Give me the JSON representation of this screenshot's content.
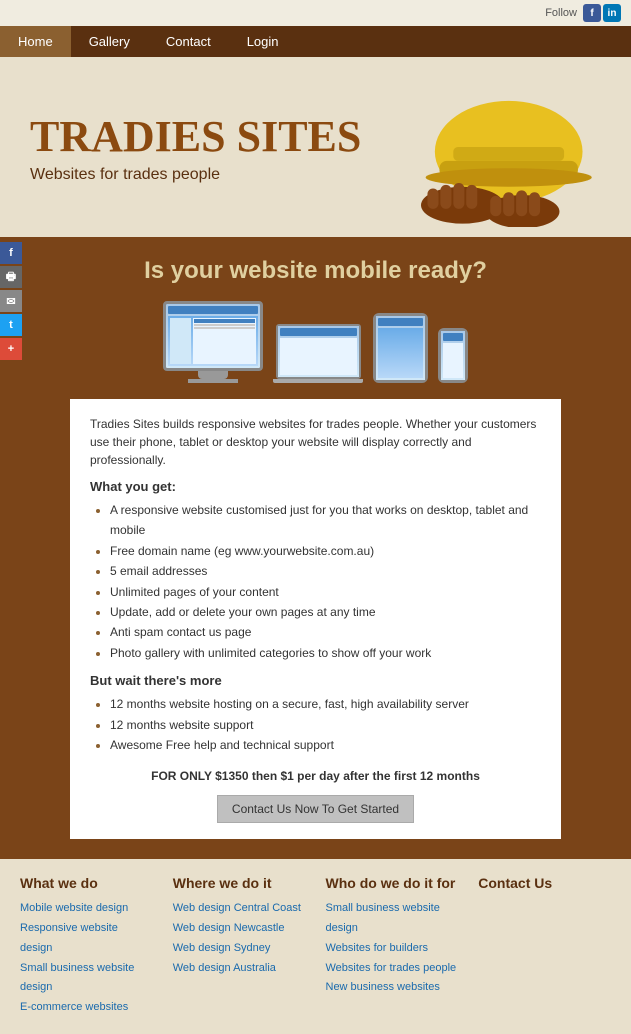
{
  "topbar": {
    "follow_label": "Follow"
  },
  "nav": {
    "items": [
      {
        "label": "Home",
        "active": true
      },
      {
        "label": "Gallery",
        "active": false
      },
      {
        "label": "Contact",
        "active": false
      },
      {
        "label": "Login",
        "active": false
      }
    ]
  },
  "hero": {
    "title": "TRADIES SITES",
    "subtitle": "Websites for trades people"
  },
  "main": {
    "headline": "Is your website mobile ready?",
    "intro": "Tradies Sites builds responsive websites for trades people. Whether your customers use their phone, tablet or desktop your website will display correctly and professionally.",
    "what_you_get_label": "What you get:",
    "features": [
      "A responsive website customised just for you that works on desktop, tablet and mobile",
      "Free domain name (eg www.yourwebsite.com.au)",
      "5 email addresses",
      "Unlimited pages of your content",
      "Update, add or delete your own pages at any time",
      "Anti spam contact us page",
      "Photo gallery with unlimited categories to show off your work"
    ],
    "more_label": "But wait there's more",
    "more_features": [
      "12 months website hosting on a secure, fast, high availability server",
      "12 months website support",
      "Awesome Free help and technical support"
    ],
    "price": "FOR ONLY $1350 then $1 per day after the first 12 months",
    "cta_button": "Contact Us Now To Get Started"
  },
  "footer": {
    "col1": {
      "heading": "What we do",
      "links": [
        "Mobile website design",
        "Responsive website design",
        "Small business website design",
        "E-commerce websites"
      ]
    },
    "col2": {
      "heading": "Where we do it",
      "links": [
        "Web design Central Coast",
        "Web design Newcastle",
        "Web design Sydney",
        "Web design Australia"
      ]
    },
    "col3": {
      "heading": "Who do we do it for",
      "links": [
        "Small business website design",
        "Websites for builders",
        "Websites for trades people",
        "New business websites"
      ]
    },
    "col4": {
      "heading": "Contact Us",
      "links": []
    }
  },
  "left_social": {
    "icons": [
      "f",
      "🖶",
      "✉",
      "t",
      "+"
    ]
  }
}
